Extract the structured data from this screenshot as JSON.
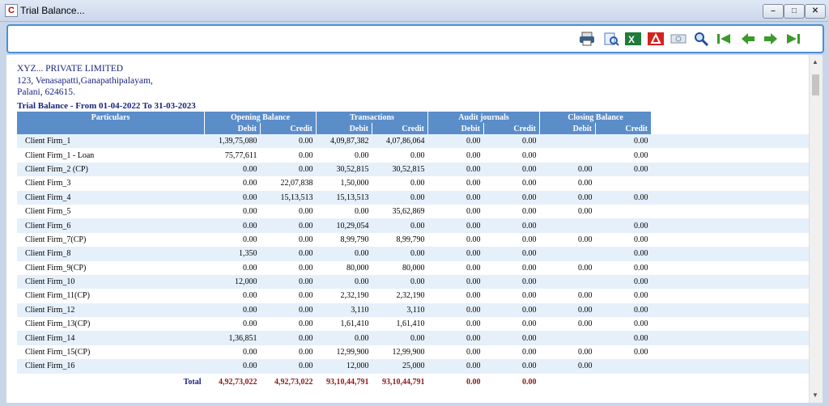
{
  "window": {
    "title": "Trial Balance..."
  },
  "company": {
    "name": "XYZ... PRIVATE LIMITED",
    "address1": "123, Venasapatti,Ganapathipalayam,",
    "address2": "Palani, 624615."
  },
  "report": {
    "title": "Trial Balance - From 01-04-2022 To 31-03-2023"
  },
  "columns": {
    "particulars": "Particulars",
    "opening": "Opening Balance",
    "transactions": "Transactions",
    "audit": "Audit journals",
    "closing": "Closing Balance",
    "debit": "Debit",
    "credit": "Credit"
  },
  "rows": [
    {
      "name": "Client Firm_1",
      "c": [
        "1,39,75,080",
        "0.00",
        "4,09,87,382",
        "4,07,86,064",
        "0.00",
        "0.00",
        "",
        "0.00"
      ]
    },
    {
      "name": "Client Firm_1 - Loan",
      "c": [
        "75,77,611",
        "0.00",
        "0.00",
        "0.00",
        "0.00",
        "0.00",
        "",
        "0.00"
      ]
    },
    {
      "name": "Client Firm_2 (CP)",
      "c": [
        "0.00",
        "0.00",
        "30,52,815",
        "30,52,815",
        "0.00",
        "0.00",
        "0.00",
        "0.00"
      ]
    },
    {
      "name": "Client Firm_3",
      "c": [
        "0.00",
        "22,07,838",
        "1,50,000",
        "0.00",
        "0.00",
        "0.00",
        "0.00",
        ""
      ]
    },
    {
      "name": "Client Firm_4",
      "c": [
        "0.00",
        "15,13,513",
        "15,13,513",
        "0.00",
        "0.00",
        "0.00",
        "0.00",
        "0.00"
      ]
    },
    {
      "name": "Client Firm_5",
      "c": [
        "0.00",
        "0.00",
        "0.00",
        "35,62,869",
        "0.00",
        "0.00",
        "0.00",
        ""
      ]
    },
    {
      "name": "Client Firm_6",
      "c": [
        "0.00",
        "0.00",
        "10,29,054",
        "0.00",
        "0.00",
        "0.00",
        "",
        "0.00"
      ]
    },
    {
      "name": "Client Firm_7(CP)",
      "c": [
        "0.00",
        "0.00",
        "8,99,790",
        "8,99,790",
        "0.00",
        "0.00",
        "0.00",
        "0.00"
      ]
    },
    {
      "name": "Client Firm_8",
      "c": [
        "1,350",
        "0.00",
        "0.00",
        "0.00",
        "0.00",
        "0.00",
        "",
        "0.00"
      ]
    },
    {
      "name": "Client Firm_9(CP)",
      "c": [
        "0.00",
        "0.00",
        "80,000",
        "80,000",
        "0.00",
        "0.00",
        "0.00",
        "0.00"
      ]
    },
    {
      "name": "Client Firm_10",
      "c": [
        "12,000",
        "0.00",
        "0.00",
        "0.00",
        "0.00",
        "0.00",
        "",
        "0.00"
      ]
    },
    {
      "name": "Client Firm_11(CP)",
      "c": [
        "0.00",
        "0.00",
        "2,32,190",
        "2,32,190",
        "0.00",
        "0.00",
        "0.00",
        "0.00"
      ]
    },
    {
      "name": "Client Firm_12",
      "c": [
        "0.00",
        "0.00",
        "3,110",
        "3,110",
        "0.00",
        "0.00",
        "0.00",
        "0.00"
      ]
    },
    {
      "name": "Client Firm_13(CP)",
      "c": [
        "0.00",
        "0.00",
        "1,61,410",
        "1,61,410",
        "0.00",
        "0.00",
        "0.00",
        "0.00"
      ]
    },
    {
      "name": "Client Firm_14",
      "c": [
        "1,36,851",
        "0.00",
        "0.00",
        "0.00",
        "0.00",
        "0.00",
        "",
        "0.00"
      ]
    },
    {
      "name": "Client Firm_15(CP)",
      "c": [
        "0.00",
        "0.00",
        "12,99,900",
        "12,99,900",
        "0.00",
        "0.00",
        "0.00",
        "0.00"
      ]
    },
    {
      "name": "Client Firm_16",
      "c": [
        "0.00",
        "0.00",
        "12,000",
        "25,000",
        "0.00",
        "0.00",
        "0.00",
        ""
      ]
    }
  ],
  "total": {
    "label": "Total",
    "c": [
      "4,92,73,022",
      "4,92,73,022",
      "93,10,44,791",
      "93,10,44,791",
      "0.00",
      "0.00"
    ]
  }
}
